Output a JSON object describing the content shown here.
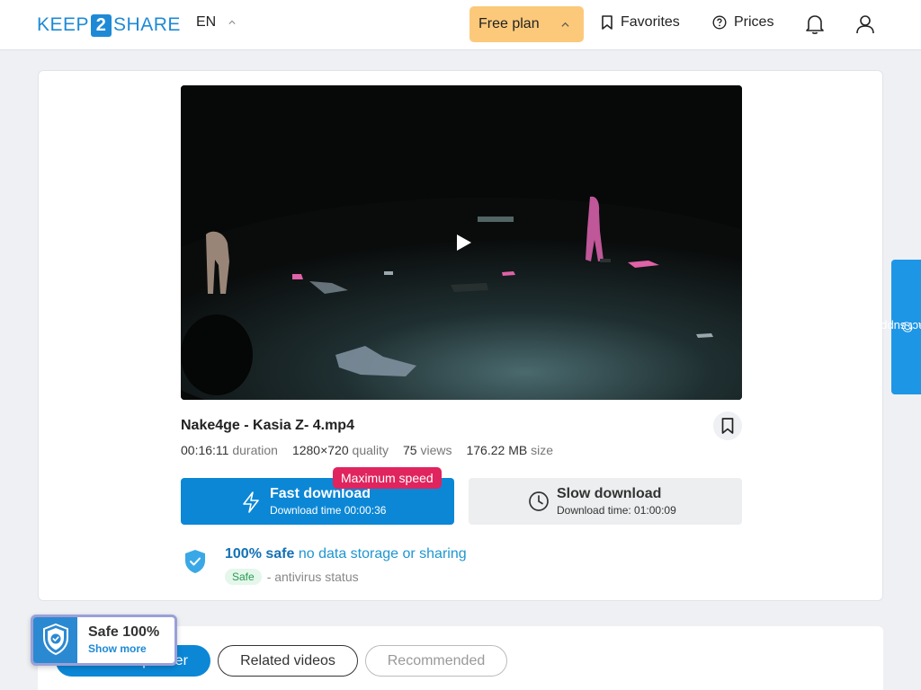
{
  "header": {
    "logo": {
      "left": "KEEP",
      "mid": "2",
      "right": "SHARE"
    },
    "language": "EN",
    "plan_label": "Free plan",
    "favorites_label": "Favorites",
    "prices_label": "Prices"
  },
  "file": {
    "title": "Nake4ge - Kasia Z- 4.mp4",
    "duration": "00:16:11",
    "duration_label": "duration",
    "quality": "1280×720",
    "quality_label": "quality",
    "views": "75",
    "views_label": "views",
    "size": "176.22 MB",
    "size_label": "size"
  },
  "download": {
    "fast_label": "Fast download",
    "fast_time": "Download time 00:00:36",
    "max_speed_badge": "Maximum speed",
    "slow_label": "Slow download",
    "slow_time": "Download time: 01:00:09"
  },
  "safety": {
    "safe_bold": "100% safe",
    "safe_rest": "no data storage or sharing",
    "status_tag": "Safe",
    "status_text": "- antivirus status"
  },
  "support_label": "contact support",
  "tabs": [
    {
      "label": "From this partner"
    },
    {
      "label": "Related videos"
    },
    {
      "label": "Recommended"
    }
  ],
  "safe_widget": {
    "title": "Safe 100%",
    "link": "Show more"
  },
  "colors": {
    "accent": "#0b87d6",
    "plan": "#fcc97a",
    "badge": "#e0245e",
    "support": "#1e96e6"
  }
}
